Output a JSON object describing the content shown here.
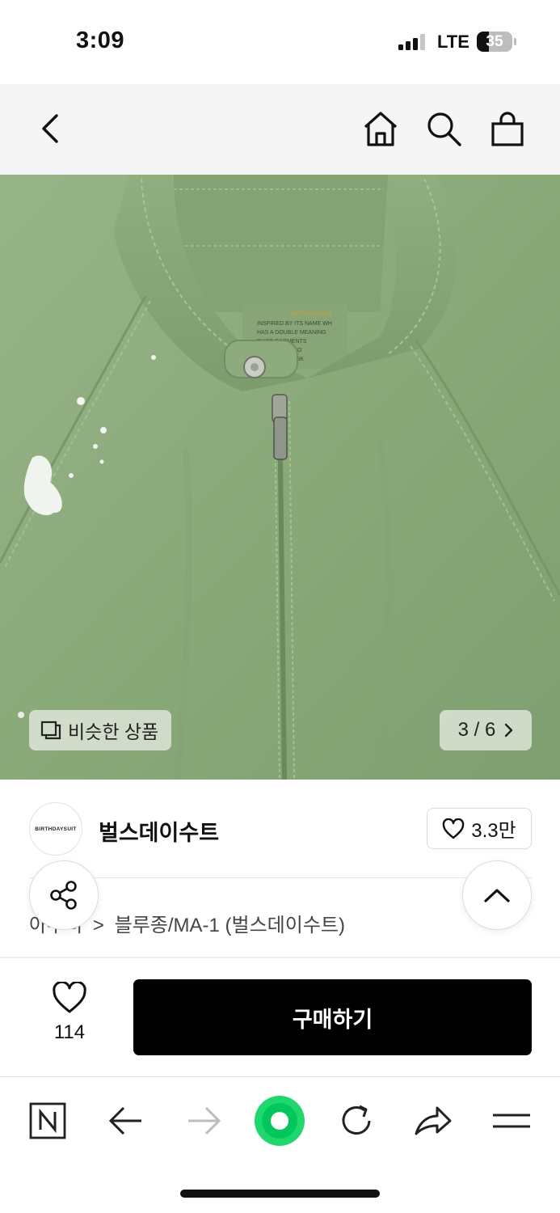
{
  "status": {
    "time": "3:09",
    "network": "LTE",
    "battery": "35",
    "battery_level": 0.35
  },
  "top_nav": {
    "icons": [
      "back-arrow-icon",
      "home-icon",
      "search-icon",
      "shopping-bag-icon"
    ]
  },
  "gallery": {
    "similar_label": "비슷한 상품",
    "pager": "3 / 6"
  },
  "brand": {
    "logo_text": "BIRTHDAYSUIT",
    "name": "벌스데이수트",
    "favorite_count": "3.3만"
  },
  "breadcrumb": {
    "prefix": "아우터",
    "separator": ">",
    "category": "블루종/MA-1 (벌스데이수트)"
  },
  "purchase": {
    "like_count": "114",
    "buy_label": "구매하기"
  },
  "browser_toolbar": {
    "icons": [
      "naver-n-icon",
      "back-icon",
      "forward-icon",
      "green-dot-icon",
      "refresh-icon",
      "share-icon",
      "menu-icon"
    ]
  },
  "colors": {
    "jacket_green": "#8dab7c",
    "buy_button": "#000000",
    "brand_accent": "#03c75a"
  }
}
